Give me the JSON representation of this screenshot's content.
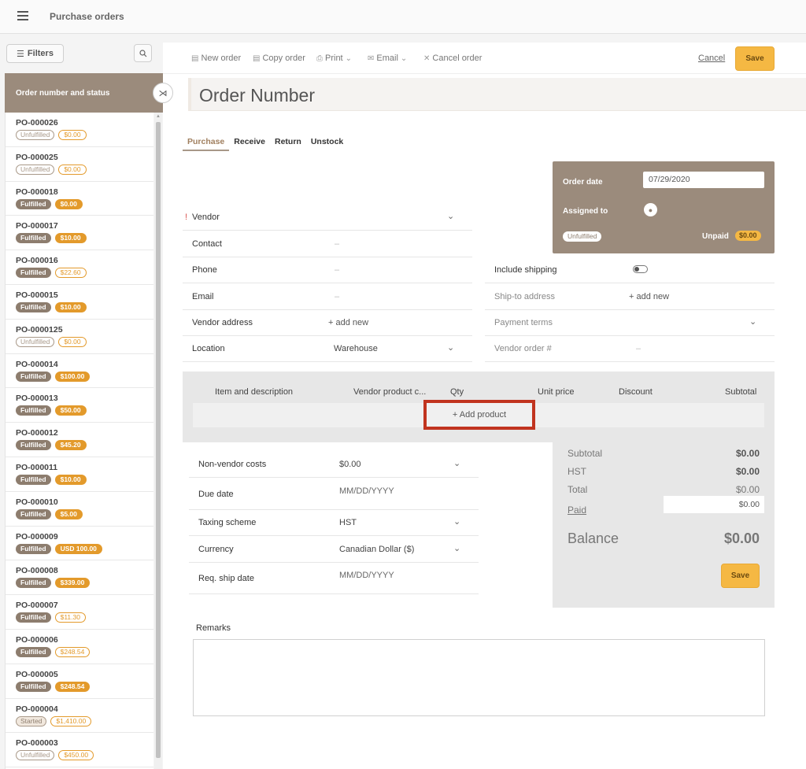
{
  "app": {
    "title": "Purchase orders"
  },
  "sidebar": {
    "filters_label": "Filters",
    "list_header": "Order number and status",
    "orders": [
      {
        "number": "PO-000026",
        "status": "Unfulfilled",
        "status_style": "outline",
        "amount": "$0.00",
        "amount_style": "outline"
      },
      {
        "number": "PO-000025",
        "status": "Unfulfilled",
        "status_style": "outline",
        "amount": "$0.00",
        "amount_style": "outline"
      },
      {
        "number": "PO-000018",
        "status": "Fulfilled",
        "status_style": "filled",
        "amount": "$0.00",
        "amount_style": "filled"
      },
      {
        "number": "PO-000017",
        "status": "Fulfilled",
        "status_style": "filled",
        "amount": "$10.00",
        "amount_style": "filled"
      },
      {
        "number": "PO-000016",
        "status": "Fulfilled",
        "status_style": "filled",
        "amount": "$22.60",
        "amount_style": "outline"
      },
      {
        "number": "PO-000015",
        "status": "Fulfilled",
        "status_style": "filled",
        "amount": "$10.00",
        "amount_style": "filled"
      },
      {
        "number": "PO-0000125",
        "status": "Unfulfilled",
        "status_style": "outline",
        "amount": "$0.00",
        "amount_style": "outline"
      },
      {
        "number": "PO-000014",
        "status": "Fulfilled",
        "status_style": "filled",
        "amount": "$100.00",
        "amount_style": "filled"
      },
      {
        "number": "PO-000013",
        "status": "Fulfilled",
        "status_style": "filled",
        "amount": "$50.00",
        "amount_style": "filled"
      },
      {
        "number": "PO-000012",
        "status": "Fulfilled",
        "status_style": "filled",
        "amount": "$45.20",
        "amount_style": "filled"
      },
      {
        "number": "PO-000011",
        "status": "Fulfilled",
        "status_style": "filled",
        "amount": "$10.00",
        "amount_style": "filled"
      },
      {
        "number": "PO-000010",
        "status": "Fulfilled",
        "status_style": "filled",
        "amount": "$5.00",
        "amount_style": "filled"
      },
      {
        "number": "PO-000009",
        "status": "Fulfilled",
        "status_style": "filled",
        "amount": "USD 100.00",
        "amount_style": "filled"
      },
      {
        "number": "PO-000008",
        "status": "Fulfilled",
        "status_style": "filled",
        "amount": "$339.00",
        "amount_style": "filled"
      },
      {
        "number": "PO-000007",
        "status": "Fulfilled",
        "status_style": "filled",
        "amount": "$11.30",
        "amount_style": "outline"
      },
      {
        "number": "PO-000006",
        "status": "Fulfilled",
        "status_style": "filled",
        "amount": "$248.54",
        "amount_style": "outline"
      },
      {
        "number": "PO-000005",
        "status": "Fulfilled",
        "status_style": "filled",
        "amount": "$248.54",
        "amount_style": "filled"
      },
      {
        "number": "PO-000004",
        "status": "Started",
        "status_style": "started",
        "amount": "$1,410.00",
        "amount_style": "outline"
      },
      {
        "number": "PO-000003",
        "status": "Unfulfilled",
        "status_style": "outline",
        "amount": "$450.00",
        "amount_style": "outline"
      }
    ]
  },
  "toolbar": {
    "new_order": "New order",
    "copy_order": "Copy order",
    "print": "Print",
    "email": "Email",
    "cancel_order": "Cancel order",
    "cancel": "Cancel",
    "save": "Save"
  },
  "order": {
    "title_placeholder": "Order Number",
    "tabs": [
      "Purchase",
      "Receive",
      "Return",
      "Unstock"
    ],
    "summary": {
      "order_date_label": "Order date",
      "order_date": "07/29/2020",
      "assigned_to_label": "Assigned to",
      "status": "Unfulfilled",
      "payment_status": "Unpaid",
      "amount": "$0.00"
    },
    "left_fields": {
      "vendor": "Vendor",
      "contact": "Contact",
      "contact_value": "–",
      "phone": "Phone",
      "phone_value": "–",
      "email": "Email",
      "email_value": "–",
      "vendor_address": "Vendor address",
      "vendor_address_action": "+ add new",
      "location": "Location",
      "location_value": "Warehouse"
    },
    "right_fields": {
      "include_shipping": "Include shipping",
      "ship_to_address": "Ship-to address",
      "ship_to_action": "+ add new",
      "payment_terms": "Payment terms",
      "vendor_order": "Vendor order #",
      "vendor_order_value": "–"
    },
    "items_table": {
      "headers": [
        "Item and description",
        "Vendor product c...",
        "Qty",
        "Unit price",
        "Discount",
        "Subtotal"
      ],
      "add_product": "+ Add product"
    },
    "extra_fields": {
      "non_vendor_costs": "Non-vendor costs",
      "non_vendor_costs_value": "$0.00",
      "due_date": "Due date",
      "due_date_placeholder": "MM/DD/YYYY",
      "taxing_scheme": "Taxing scheme",
      "taxing_scheme_value": "HST",
      "currency": "Currency",
      "currency_value": "Canadian Dollar ($)",
      "req_ship_date": "Req. ship date",
      "req_ship_date_placeholder": "MM/DD/YYYY"
    },
    "totals": {
      "subtotal_label": "Subtotal",
      "subtotal": "$0.00",
      "hst_label": "HST",
      "hst": "$0.00",
      "total_label": "Total",
      "total": "$0.00",
      "paid_label": "Paid",
      "paid": "$0.00",
      "balance_label": "Balance",
      "balance": "$0.00",
      "save": "Save"
    },
    "remarks_label": "Remarks"
  },
  "icons": {
    "menu": "hamburger-icon",
    "search": "search-icon",
    "collapse": "collapse-panel-icon",
    "avatar": "user-icon"
  },
  "colors": {
    "brand_taupe": "#9b8b7c",
    "accent_orange": "#e39a2b",
    "save_yellow": "#f5b843",
    "highlight_red": "#c1341f"
  }
}
